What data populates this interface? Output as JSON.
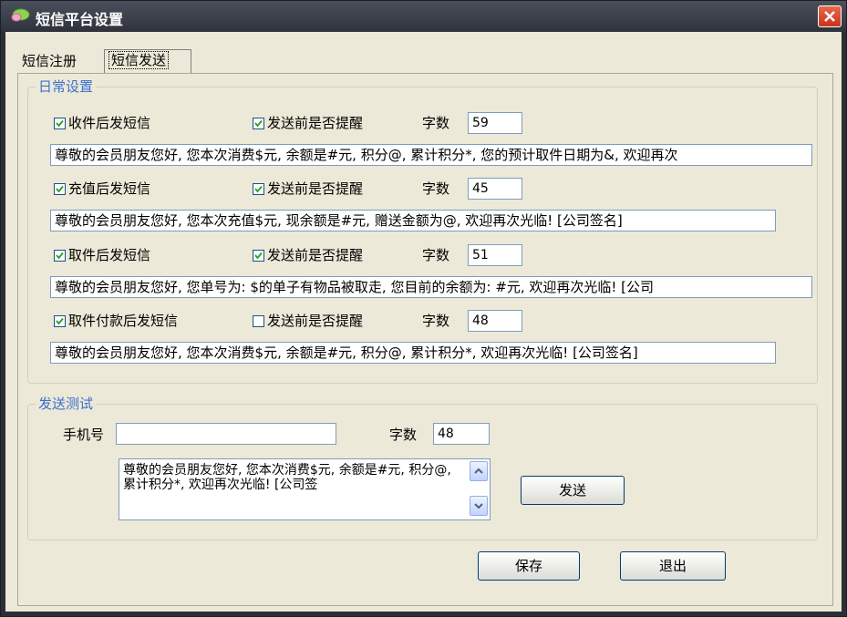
{
  "window": {
    "title": "短信平台设置"
  },
  "tabs": [
    {
      "label": "短信注册"
    },
    {
      "label": "短信发送"
    }
  ],
  "daily": {
    "title": "日常设置",
    "count_label": "字数",
    "rows": [
      {
        "label": "收件后发短信",
        "checked": true,
        "remind_label": "发送前是否提醒",
        "remind_checked": true,
        "count": "59",
        "message": "尊敬的会员朋友您好, 您本次消费$元, 余额是#元, 积分@, 累计积分*, 您的预计取件日期为&, 欢迎再次"
      },
      {
        "label": "充值后发短信",
        "checked": true,
        "remind_label": "发送前是否提醒",
        "remind_checked": true,
        "count": "45",
        "message": "尊敬的会员朋友您好, 您本次充值$元, 现余额是#元, 赠送金额为@, 欢迎再次光临! [公司签名]"
      },
      {
        "label": "取件后发短信",
        "checked": true,
        "remind_label": "发送前是否提醒",
        "remind_checked": true,
        "count": "51",
        "message": "尊敬的会员朋友您好, 您单号为: $的单子有物品被取走, 您目前的余额为: #元, 欢迎再次光临! [公司"
      },
      {
        "label": "取件付款后发短信",
        "checked": true,
        "remind_label": "发送前是否提醒",
        "remind_checked": false,
        "count": "48",
        "message": "尊敬的会员朋友您好, 您本次消费$元, 余额是#元, 积分@, 累计积分*, 欢迎再次光临! [公司签名]"
      }
    ]
  },
  "test": {
    "title": "发送测试",
    "phone_label": "手机号",
    "phone_value": "",
    "count_label": "字数",
    "count": "48",
    "message": "尊敬的会员朋友您好, 您本次消费$元, 余额是#元, 积分@, 累计积分*, 欢迎再次光临! [公司签",
    "send_label": "发送"
  },
  "footer": {
    "save_label": "保存",
    "exit_label": "退出"
  },
  "icons": {
    "app": "sms-bubble-icon",
    "close": "close-icon",
    "up": "chevron-up-icon",
    "down": "chevron-down-icon",
    "check": "checkmark-icon"
  },
  "colors": {
    "group_title": "#3d6fcf",
    "close": "#d9482a",
    "panel": "#ece9d8"
  }
}
